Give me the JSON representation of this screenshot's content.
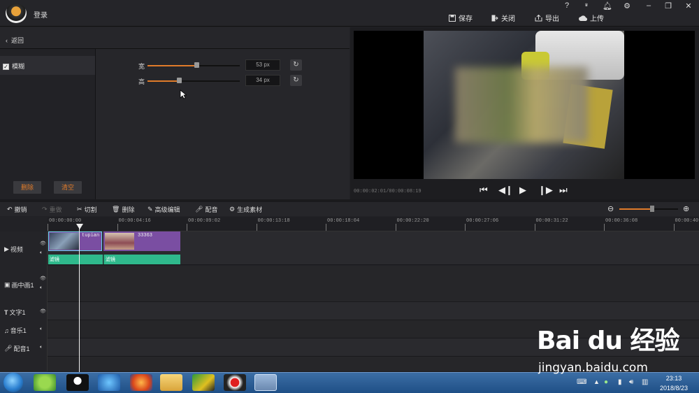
{
  "header": {
    "login": "登录",
    "actions": [
      {
        "label": "保存",
        "icon": "save-icon"
      },
      {
        "label": "关闭",
        "icon": "exit-icon"
      },
      {
        "label": "导出",
        "icon": "export-icon"
      },
      {
        "label": "上传",
        "icon": "upload-icon"
      }
    ],
    "window_controls": [
      "?",
      "VIP",
      "bell",
      "gear",
      "minimize",
      "restore",
      "close"
    ]
  },
  "left_panel": {
    "back_label": "返回",
    "effect_label": "模糊",
    "effect_checked": true,
    "delete_label": "删除",
    "clear_label": "清空",
    "sliders": [
      {
        "label": "宽",
        "value_text": "53 px",
        "fraction": 0.53
      },
      {
        "label": "高",
        "value_text": "34 px",
        "fraction": 0.34
      }
    ]
  },
  "preview": {
    "timecode": "00:00:02:01/00:00:08:19"
  },
  "toolbar": {
    "tools": [
      {
        "label": "撤销",
        "icon": "undo-icon",
        "enabled": true
      },
      {
        "label": "重做",
        "icon": "redo-icon",
        "enabled": false
      },
      {
        "label": "切割",
        "icon": "scissors-icon",
        "enabled": true
      },
      {
        "label": "删除",
        "icon": "trash-icon",
        "enabled": true
      },
      {
        "label": "高级编辑",
        "icon": "pencil-icon",
        "enabled": true
      },
      {
        "label": "配音",
        "icon": "microphone-icon",
        "enabled": true
      },
      {
        "label": "生成素材",
        "icon": "film-reel-icon",
        "enabled": true
      }
    ],
    "zoom_fraction": 0.57
  },
  "ruler": {
    "ticks": [
      "00:00:00:00",
      "00:00:04:16",
      "00:00:09:02",
      "00:00:13:18",
      "00:00:18:04",
      "00:00:22:20",
      "00:00:27:06",
      "00:00:31:22",
      "00:00:36:08",
      "00:00:40:"
    ]
  },
  "tracks": [
    {
      "label": "视频",
      "icon": "play-icon"
    },
    {
      "label": "画中画1",
      "icon": "pip-icon"
    },
    {
      "label": "文字1",
      "icon": "text-icon"
    },
    {
      "label": "音乐1",
      "icon": "music-icon"
    },
    {
      "label": "配音1",
      "icon": "microphone-icon"
    }
  ],
  "clips": [
    {
      "name": "tupian",
      "filter": "滤镜"
    },
    {
      "name": "33363",
      "filter": "滤镜"
    }
  ],
  "taskbar": {
    "time": "23:13",
    "date": "2018/8/23"
  },
  "watermark": {
    "logo": "Bai du 经验",
    "url": "jingyan.baidu.com"
  }
}
